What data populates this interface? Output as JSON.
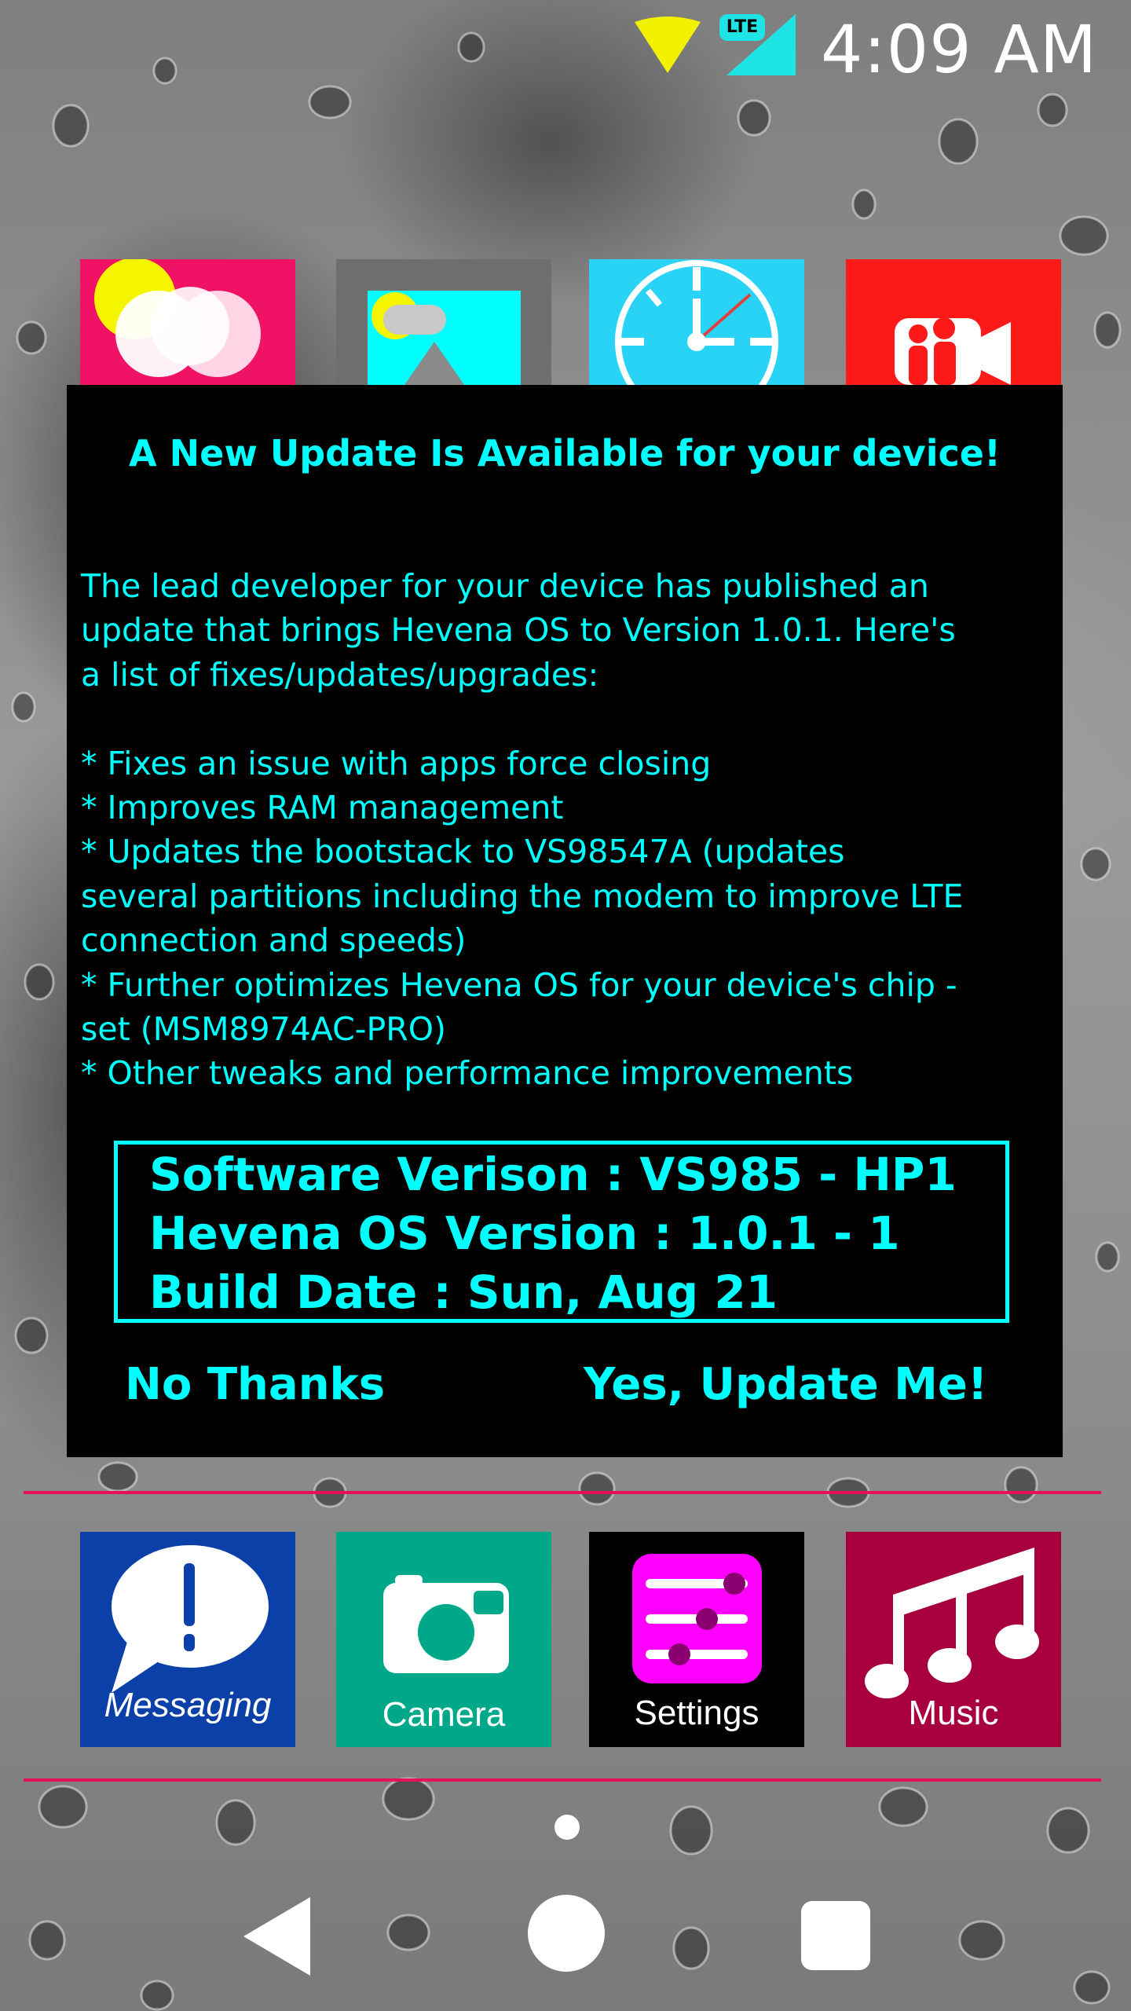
{
  "status_bar": {
    "time": "4:09 AM",
    "network_badge": "LTE",
    "icons": [
      "wifi-icon",
      "cell-signal-icon"
    ],
    "colors": {
      "wifi": "#f2f200",
      "signal": "#1fe4e6"
    }
  },
  "top_apps": [
    {
      "name": "photos-app-icon",
      "color": "#f01265"
    },
    {
      "name": "gallery-app-icon",
      "color": "#6e6e6e"
    },
    {
      "name": "clock-app-icon",
      "color": "#29d3f5"
    },
    {
      "name": "video-app-icon",
      "color": "#ff1a1a"
    }
  ],
  "dialog": {
    "title": "A New Update Is Available for your device!",
    "body": "The lead developer for your device has published an\nupdate that brings Hevena OS to Version 1.0.1. Here's\na list of fixes/updates/upgrades:\n\n* Fixes an issue with apps force closing\n* Improves RAM management\n* Updates the bootstack to VS98547A (updates\nseveral partitions including the modem to improve LTE\nconnection and speeds)\n* Further optimizes Hevena OS for your device's chip -\nset (MSM8974AC-PRO)\n* Other tweaks and performance improvements",
    "software_version": "Software Verison : VS985 - HP1",
    "os_version": "Hevena OS Version : 1.0.1 - 1",
    "build_date": "Build Date : Sun, Aug 21",
    "decline_label": "No Thanks",
    "accept_label": "Yes, Update Me!",
    "text_color": "#00ffff",
    "background": "#000000"
  },
  "dock": {
    "divider_color": "#e8105a",
    "apps": [
      {
        "label": "Messaging",
        "color": "#0a40a8",
        "icon": "message-bubble-icon"
      },
      {
        "label": "Camera",
        "color": "#00a88a",
        "icon": "camera-icon"
      },
      {
        "label": "Settings",
        "color": "#000000",
        "icon": "sliders-icon"
      },
      {
        "label": "Music",
        "color": "#a8003e",
        "icon": "music-notes-icon"
      }
    ]
  },
  "nav_bar": {
    "buttons": [
      "back-icon",
      "home-icon",
      "recents-icon"
    ]
  }
}
